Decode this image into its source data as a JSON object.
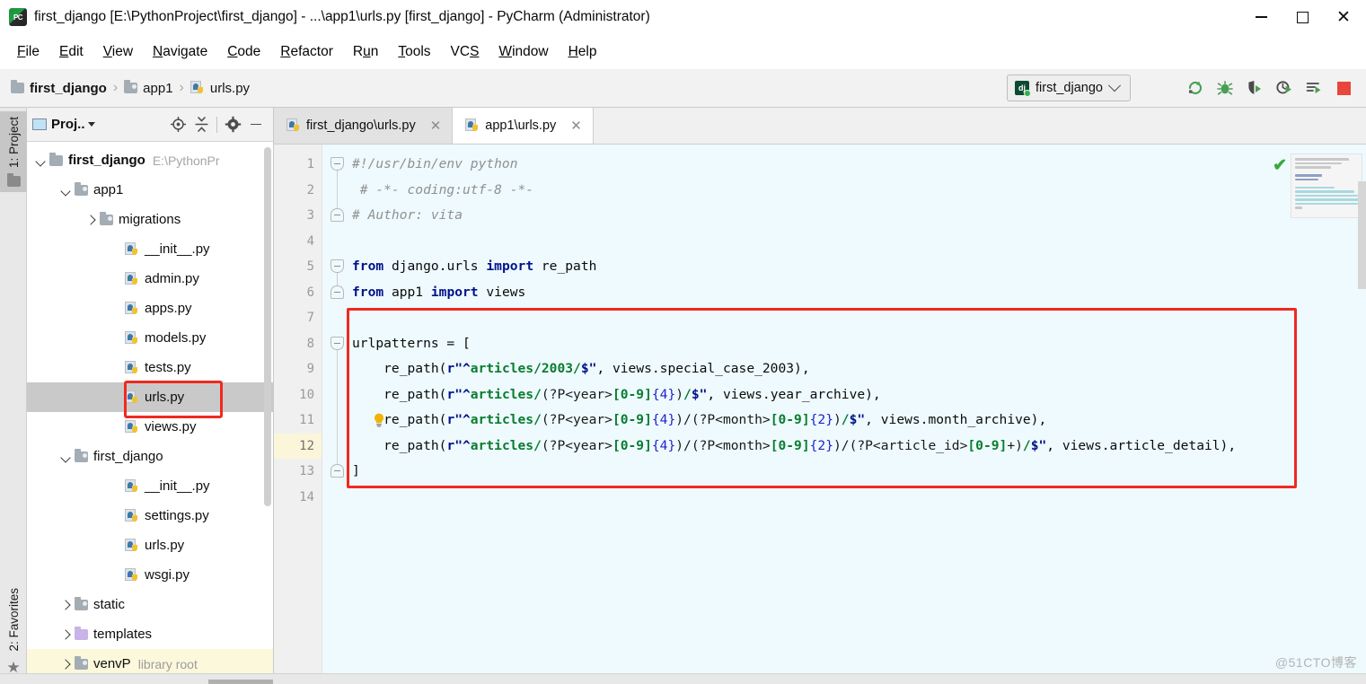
{
  "window": {
    "title": "first_django [E:\\PythonProject\\first_django] - ...\\app1\\urls.py [first_django] - PyCharm (Administrator)",
    "app_icon": "pycharm-icon",
    "controls": {
      "minimize": "—",
      "maximize": "☐",
      "close": "✕"
    }
  },
  "menubar": {
    "items": [
      {
        "label": "File",
        "mnemonic": "F"
      },
      {
        "label": "Edit",
        "mnemonic": "E"
      },
      {
        "label": "View",
        "mnemonic": "V"
      },
      {
        "label": "Navigate",
        "mnemonic": "N"
      },
      {
        "label": "Code",
        "mnemonic": "C"
      },
      {
        "label": "Refactor",
        "mnemonic": "R"
      },
      {
        "label": "Run",
        "mnemonic": "u"
      },
      {
        "label": "Tools",
        "mnemonic": "T"
      },
      {
        "label": "VCS",
        "mnemonic": "S"
      },
      {
        "label": "Window",
        "mnemonic": "W"
      },
      {
        "label": "Help",
        "mnemonic": "H"
      }
    ]
  },
  "navbar": {
    "breadcrumbs": [
      {
        "label": "first_django",
        "icon": "folder-icon",
        "bold": true
      },
      {
        "label": "app1",
        "icon": "module-folder-icon",
        "bold": false
      },
      {
        "label": "urls.py",
        "icon": "python-file-icon",
        "bold": false
      }
    ],
    "separator": "›",
    "run_config": {
      "label": "first_django",
      "icon": "django-icon",
      "chevron": "chevron-down-icon"
    },
    "toolbar_buttons": [
      {
        "name": "rerun-button",
        "title": "Rerun"
      },
      {
        "name": "debug-button",
        "title": "Debug"
      },
      {
        "name": "coverage-button",
        "title": "Run with Coverage"
      },
      {
        "name": "profile-button",
        "title": "Profile"
      },
      {
        "name": "run-to-line-button",
        "title": "Run to Line"
      },
      {
        "name": "stop-button",
        "title": "Stop",
        "color": "#e8453c"
      }
    ]
  },
  "toolstrip": {
    "top": {
      "label": "1: Project",
      "mnemonic": "1",
      "icon": "project-folder-icon",
      "active": true
    },
    "bottom": {
      "label": "2: Favorites",
      "mnemonic": "2",
      "icon": "star-icon",
      "active": false
    }
  },
  "project_panel": {
    "header": {
      "title": "Proj..",
      "window_icon": "project-window-icon",
      "caret": "caret-down-icon",
      "buttons": [
        {
          "name": "locate-icon",
          "title": "Select Opened File"
        },
        {
          "name": "collapse-all-icon",
          "title": "Collapse All"
        },
        {
          "name": "gear-icon",
          "title": "Settings"
        },
        {
          "name": "minimize-icon",
          "title": "Hide"
        }
      ]
    },
    "tree": [
      {
        "label": "first_django",
        "sub": "E:\\PythonPr",
        "icon": "folder-icon",
        "arrow": "down",
        "indent": 0,
        "bold": true,
        "selected": false
      },
      {
        "label": "app1",
        "sub": "",
        "icon": "module-folder-icon",
        "arrow": "down",
        "indent": 1,
        "bold": false,
        "selected": false
      },
      {
        "label": "migrations",
        "sub": "",
        "icon": "module-folder-icon",
        "arrow": "right",
        "indent": 2,
        "bold": false,
        "selected": false
      },
      {
        "label": "__init__.py",
        "sub": "",
        "icon": "python-file-icon",
        "arrow": "none",
        "indent": 3,
        "bold": false,
        "selected": false
      },
      {
        "label": "admin.py",
        "sub": "",
        "icon": "python-file-icon",
        "arrow": "none",
        "indent": 3,
        "bold": false,
        "selected": false
      },
      {
        "label": "apps.py",
        "sub": "",
        "icon": "python-file-icon",
        "arrow": "none",
        "indent": 3,
        "bold": false,
        "selected": false
      },
      {
        "label": "models.py",
        "sub": "",
        "icon": "python-file-icon",
        "arrow": "none",
        "indent": 3,
        "bold": false,
        "selected": false
      },
      {
        "label": "tests.py",
        "sub": "",
        "icon": "python-file-icon",
        "arrow": "none",
        "indent": 3,
        "bold": false,
        "selected": false
      },
      {
        "label": "urls.py",
        "sub": "",
        "icon": "python-file-icon",
        "arrow": "none",
        "indent": 3,
        "bold": false,
        "selected": true
      },
      {
        "label": "views.py",
        "sub": "",
        "icon": "python-file-icon",
        "arrow": "none",
        "indent": 3,
        "bold": false,
        "selected": false
      },
      {
        "label": "first_django",
        "sub": "",
        "icon": "module-folder-icon",
        "arrow": "down",
        "indent": 1,
        "bold": false,
        "selected": false
      },
      {
        "label": "__init__.py",
        "sub": "",
        "icon": "python-file-icon",
        "arrow": "none",
        "indent": 3,
        "bold": false,
        "selected": false
      },
      {
        "label": "settings.py",
        "sub": "",
        "icon": "python-file-icon",
        "arrow": "none",
        "indent": 3,
        "bold": false,
        "selected": false
      },
      {
        "label": "urls.py",
        "sub": "",
        "icon": "python-file-icon",
        "arrow": "none",
        "indent": 3,
        "bold": false,
        "selected": false
      },
      {
        "label": "wsgi.py",
        "sub": "",
        "icon": "python-file-icon",
        "arrow": "none",
        "indent": 3,
        "bold": false,
        "selected": false
      },
      {
        "label": "static",
        "sub": "",
        "icon": "module-folder-icon",
        "arrow": "right",
        "indent": 1,
        "bold": false,
        "selected": false
      },
      {
        "label": "templates",
        "sub": "",
        "icon": "purple-folder-icon",
        "arrow": "right",
        "indent": 1,
        "bold": false,
        "selected": false
      },
      {
        "label": "venvP",
        "sub": "library root",
        "icon": "module-folder-icon",
        "arrow": "right",
        "indent": 1,
        "bold": false,
        "selected": false,
        "highlighted": true
      }
    ],
    "highlight_box": {
      "target": "urls.py",
      "color": "#ef2a20"
    }
  },
  "editor": {
    "tabs": [
      {
        "label": "first_django\\urls.py",
        "icon": "python-file-icon",
        "active": false,
        "close": "✕"
      },
      {
        "label": "app1\\urls.py",
        "icon": "python-file-icon",
        "active": true,
        "close": "✕"
      }
    ],
    "line_numbers": [
      "1",
      "2",
      "3",
      "4",
      "5",
      "6",
      "7",
      "8",
      "9",
      "10",
      "11",
      "12",
      "13",
      "14"
    ],
    "current_line": 12,
    "inspection_status": {
      "icon": "green-check-icon",
      "glyph": "✔",
      "color": "#3aa83a"
    },
    "intention_bulb": {
      "line": 11,
      "icon": "lightbulb-icon"
    },
    "annotation_box": {
      "from_line": 7,
      "to_line": 13,
      "color": "#ef2a20"
    },
    "code_lines": [
      {
        "n": 1,
        "tokens": [
          {
            "t": "#!/usr/bin/env python",
            "c": "cmt"
          }
        ]
      },
      {
        "n": 2,
        "tokens": [
          {
            "t": " # -*- coding:utf-8 -*-",
            "c": "cmt"
          }
        ]
      },
      {
        "n": 3,
        "tokens": [
          {
            "t": "# Author: vita",
            "c": "cmt"
          }
        ]
      },
      {
        "n": 4,
        "tokens": []
      },
      {
        "n": 5,
        "tokens": [
          {
            "t": "from",
            "c": "kw"
          },
          {
            "t": " django.urls ",
            "c": "plain"
          },
          {
            "t": "import",
            "c": "kw"
          },
          {
            "t": " re_path",
            "c": "plain"
          }
        ]
      },
      {
        "n": 6,
        "tokens": [
          {
            "t": "from",
            "c": "kw"
          },
          {
            "t": " app1 ",
            "c": "plain"
          },
          {
            "t": "import",
            "c": "kw"
          },
          {
            "t": " views",
            "c": "plain"
          }
        ]
      },
      {
        "n": 7,
        "tokens": []
      },
      {
        "n": 8,
        "tokens": [
          {
            "t": "urlpatterns = [",
            "c": "plain"
          }
        ]
      },
      {
        "n": 9,
        "tokens": [
          {
            "t": "    re_path(",
            "c": "plain"
          },
          {
            "t": "r\"^",
            "c": "str-pre"
          },
          {
            "t": "articles/2003/",
            "c": "str-lit"
          },
          {
            "t": "$\"",
            "c": "str-pre"
          },
          {
            "t": ", views.special_case_2003),",
            "c": "plain"
          }
        ]
      },
      {
        "n": 10,
        "tokens": [
          {
            "t": "    re_path(",
            "c": "plain"
          },
          {
            "t": "r\"^",
            "c": "str-pre"
          },
          {
            "t": "articles/",
            "c": "str-lit"
          },
          {
            "t": "(?P<year>",
            "c": "rx-grp"
          },
          {
            "t": "[0-9]",
            "c": "rx-cls"
          },
          {
            "t": "{4}",
            "c": "rx-qnt"
          },
          {
            "t": ")",
            "c": "rx-grp"
          },
          {
            "t": "/",
            "c": "str-lit"
          },
          {
            "t": "$\"",
            "c": "str-pre"
          },
          {
            "t": ", views.year_archive),",
            "c": "plain"
          }
        ]
      },
      {
        "n": 11,
        "tokens": [
          {
            "t": "    re_path(",
            "c": "plain"
          },
          {
            "t": "r\"^",
            "c": "str-pre"
          },
          {
            "t": "articles/",
            "c": "str-lit"
          },
          {
            "t": "(?P<year>",
            "c": "rx-grp"
          },
          {
            "t": "[0-9]",
            "c": "rx-cls"
          },
          {
            "t": "{4}",
            "c": "rx-qnt"
          },
          {
            "t": ")/",
            "c": "rx-grp"
          },
          {
            "t": "(?P<month>",
            "c": "rx-grp"
          },
          {
            "t": "[0-9]",
            "c": "rx-cls"
          },
          {
            "t": "{2}",
            "c": "rx-qnt"
          },
          {
            "t": ")",
            "c": "rx-grp"
          },
          {
            "t": "/",
            "c": "str-lit"
          },
          {
            "t": "$\"",
            "c": "str-pre"
          },
          {
            "t": ", views.month_archive),",
            "c": "plain"
          }
        ]
      },
      {
        "n": 12,
        "tokens": [
          {
            "t": "    re_path(",
            "c": "plain"
          },
          {
            "t": "r\"^",
            "c": "str-pre"
          },
          {
            "t": "articles/",
            "c": "str-lit"
          },
          {
            "t": "(?P<year>",
            "c": "rx-grp"
          },
          {
            "t": "[0-9]",
            "c": "rx-cls"
          },
          {
            "t": "{4}",
            "c": "rx-qnt"
          },
          {
            "t": ")/",
            "c": "rx-grp"
          },
          {
            "t": "(?P<month>",
            "c": "rx-grp"
          },
          {
            "t": "[0-9]",
            "c": "rx-cls"
          },
          {
            "t": "{2}",
            "c": "rx-qnt"
          },
          {
            "t": ")/",
            "c": "rx-grp"
          },
          {
            "t": "(?P<article_id>",
            "c": "rx-grp"
          },
          {
            "t": "[0-9]",
            "c": "rx-cls"
          },
          {
            "t": "+)",
            "c": "rx-grp"
          },
          {
            "t": "/",
            "c": "str-lit"
          },
          {
            "t": "$\"",
            "c": "str-pre"
          },
          {
            "t": ", views.article_detail),",
            "c": "plain"
          }
        ]
      },
      {
        "n": 13,
        "tokens": [
          {
            "t": "]",
            "c": "plain"
          }
        ]
      },
      {
        "n": 14,
        "tokens": []
      }
    ]
  },
  "watermark": {
    "text": "@51CTO博客"
  }
}
